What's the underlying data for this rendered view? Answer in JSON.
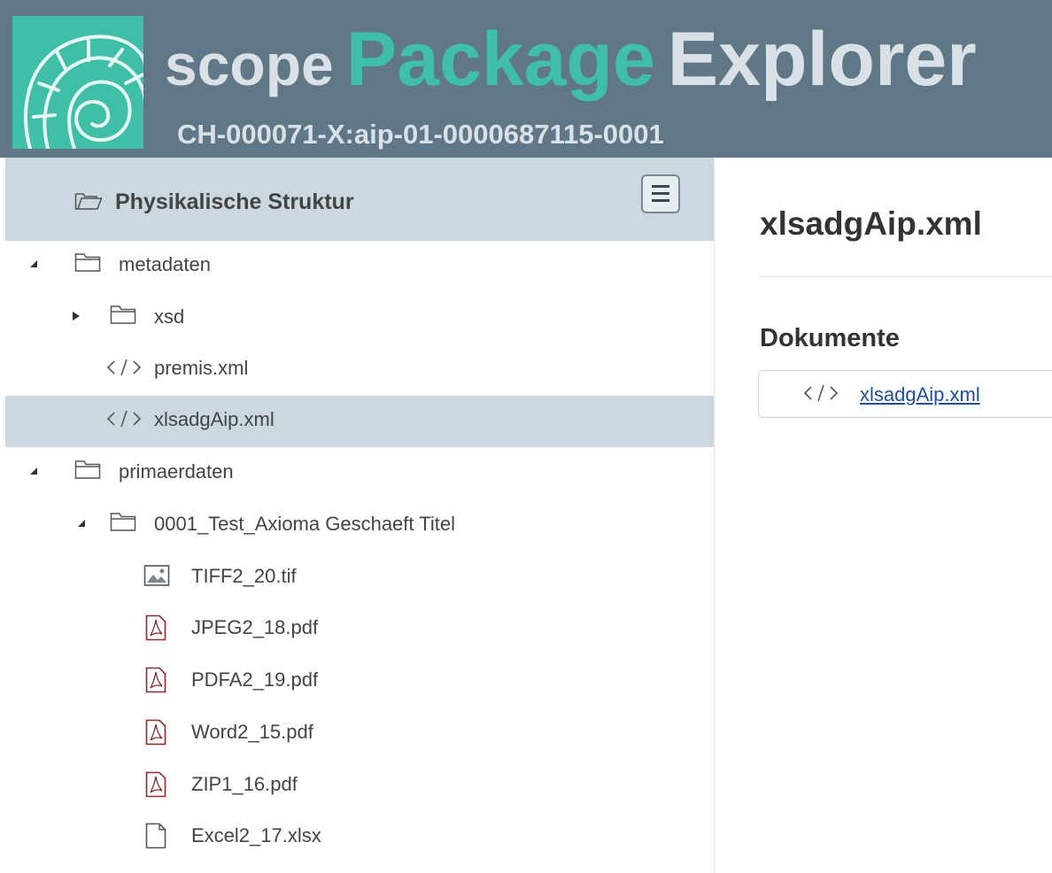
{
  "header": {
    "brand_word1": "scope",
    "brand_word2": "Package",
    "brand_word3": "Explorer",
    "package_id": "CH-000071-X:aip-01-0000687115-0001"
  },
  "sidebar": {
    "title": "Physikalische Struktur",
    "items": [
      {
        "label": "metadaten",
        "icon": "folder-icon",
        "expander": "expanded"
      },
      {
        "label": "xsd",
        "icon": "folder-icon",
        "expander": "collapsed"
      },
      {
        "label": "premis.xml",
        "icon": "code-icon"
      },
      {
        "label": "xlsadgAip.xml",
        "icon": "code-icon",
        "selected": true
      },
      {
        "label": "primaerdaten",
        "icon": "folder-icon",
        "expander": "expanded"
      },
      {
        "label": "0001_Test_Axioma Geschaeft Titel",
        "icon": "folder-icon",
        "expander": "expanded"
      },
      {
        "label": "TIFF2_20.tif",
        "icon": "image-icon"
      },
      {
        "label": "JPEG2_18.pdf",
        "icon": "pdf-icon"
      },
      {
        "label": "PDFA2_19.pdf",
        "icon": "pdf-icon"
      },
      {
        "label": "Word2_15.pdf",
        "icon": "pdf-icon"
      },
      {
        "label": "ZIP1_16.pdf",
        "icon": "pdf-icon"
      },
      {
        "label": "Excel2_17.xlsx",
        "icon": "file-icon"
      }
    ]
  },
  "main": {
    "title": "xlsadgAip.xml",
    "section_title": "Dokumente",
    "documents": [
      {
        "label": "xlsadgAip.xml",
        "icon": "code-icon"
      }
    ]
  },
  "colors": {
    "header_bg": "#5f7786",
    "accent": "#3fbfa8",
    "selection": "#ccd8e0",
    "link": "#1f4e9a"
  }
}
